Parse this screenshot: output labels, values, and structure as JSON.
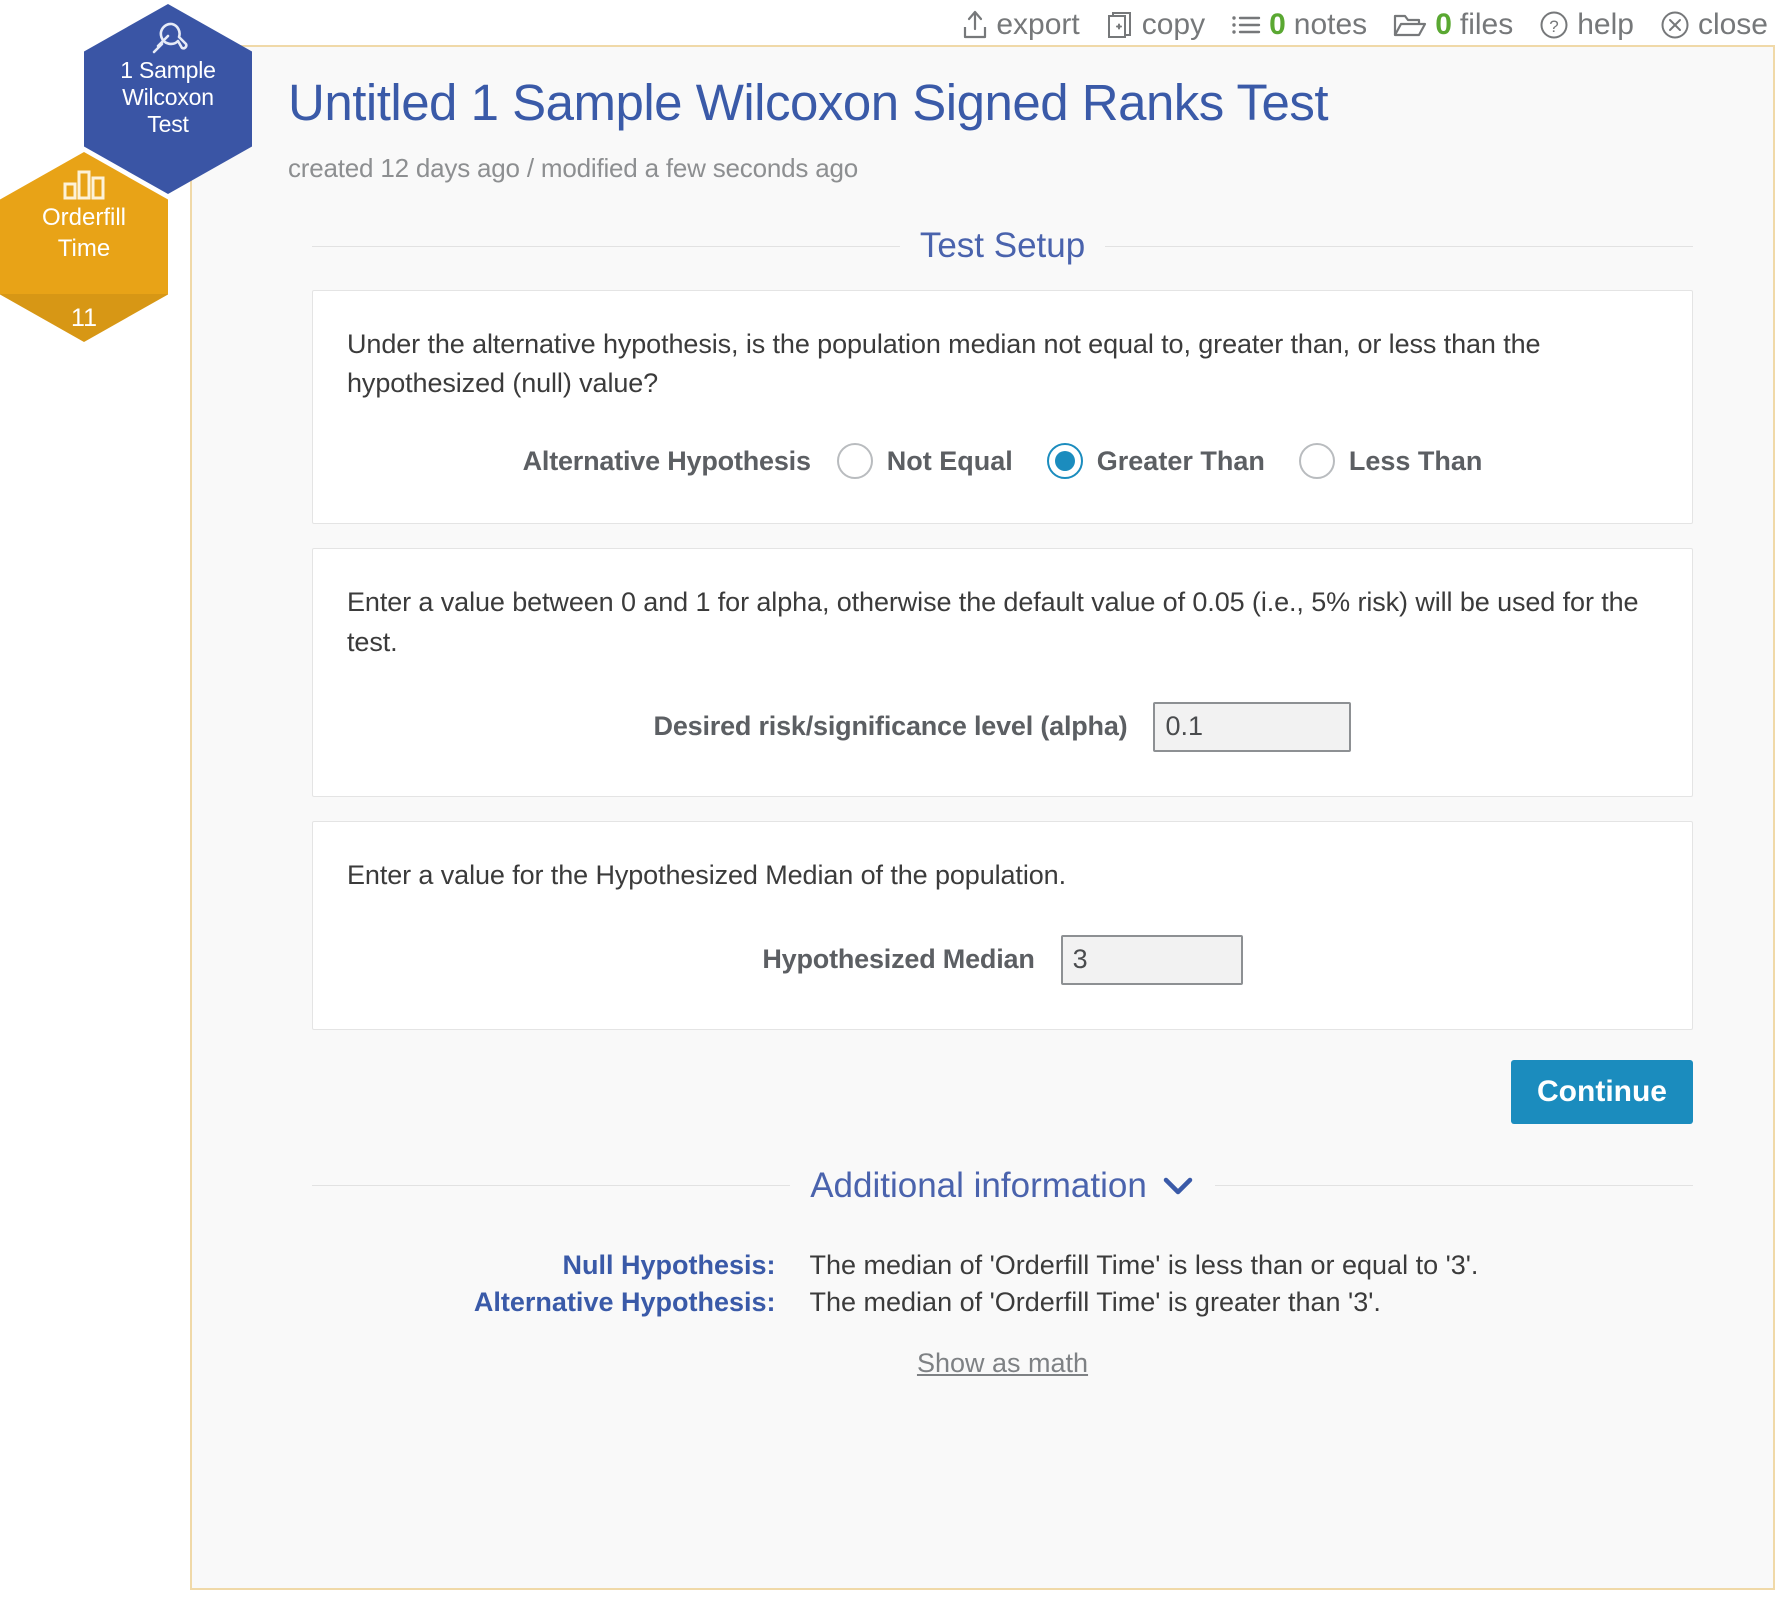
{
  "toolbar": {
    "items": [
      {
        "icon": "export-icon",
        "label": "export",
        "count": ""
      },
      {
        "icon": "copy-icon",
        "label": "copy",
        "count": ""
      },
      {
        "icon": "notes-icon",
        "label": "notes",
        "count": "0"
      },
      {
        "icon": "files-icon",
        "label": "files",
        "count": "0"
      },
      {
        "icon": "help-icon",
        "label": "help",
        "count": ""
      },
      {
        "icon": "close-icon",
        "label": "close",
        "count": ""
      }
    ]
  },
  "badges": {
    "test": {
      "icon": "wrench-icon",
      "label": "1 Sample\nWilcoxon\nTest",
      "line1": "1 Sample",
      "line2": "Wilcoxon",
      "line3": "Test",
      "color": "#3a55a5"
    },
    "data": {
      "icon": "bar-chart-icon",
      "line1": "Orderfill",
      "line2": "Time",
      "count": "11",
      "color": "#e8a317"
    }
  },
  "header": {
    "title": "Untitled 1 Sample Wilcoxon Signed Ranks Test",
    "subtitle": "created 12 days ago / modified a few seconds ago"
  },
  "sections": {
    "test_setup": {
      "title": "Test Setup"
    },
    "additional_info": {
      "title": "Additional information",
      "chevron": "⌄"
    }
  },
  "cards": {
    "hypothesis": {
      "question": "Under the alternative hypothesis, is the population median not equal to, greater than, or less than the hypothesized (null) value?",
      "field_label": "Alternative Hypothesis",
      "options": [
        {
          "label": "Not Equal",
          "selected": false
        },
        {
          "label": "Greater Than",
          "selected": true
        },
        {
          "label": "Less Than",
          "selected": false
        }
      ],
      "selected_value": "Greater Than"
    },
    "alpha": {
      "question": "Enter a value between 0 and 1 for alpha, otherwise the default value of 0.05 (i.e., 5% risk) will be used for the test.",
      "field_label": "Desired risk/significance level (alpha)",
      "value": "0.1",
      "placeholder": "0.05"
    },
    "median": {
      "question": "Enter a value for the Hypothesized Median of the population.",
      "field_label": "Hypothesized Median",
      "value": "3",
      "placeholder": ""
    }
  },
  "actions": {
    "continue_label": "Continue"
  },
  "additional": {
    "null_label": "Null Hypothesis:",
    "null_text": "The median of 'Orderfill Time' is less than or equal to '3'.",
    "alt_label": "Alternative Hypothesis:",
    "alt_text": "The median of 'Orderfill Time' is greater than '3'.",
    "show_math": "Show as math"
  },
  "colors": {
    "accent_blue": "#1b8cbe",
    "title_blue": "#3a5aa8",
    "badge_blue": "#3a55a5",
    "badge_orange": "#e8a317",
    "count_green": "#5aa832",
    "panel_border": "#f0d9a8"
  }
}
